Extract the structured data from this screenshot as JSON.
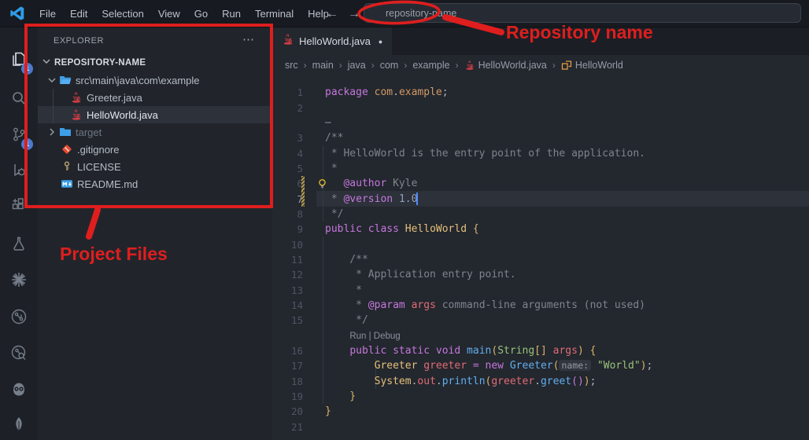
{
  "titlebar": {
    "menus": [
      "File",
      "Edit",
      "Selection",
      "View",
      "Go",
      "Run",
      "Terminal",
      "Help"
    ],
    "back_icon": "←",
    "forward_icon": "→",
    "search_value": "repository-name"
  },
  "activity_bar": {
    "items": [
      {
        "name": "explorer",
        "badge": "1"
      },
      {
        "name": "search"
      },
      {
        "name": "source-control",
        "badge": "1"
      },
      {
        "name": "run-debug"
      },
      {
        "name": "extensions"
      },
      {
        "name": "testing-flask"
      },
      {
        "name": "sparkle"
      },
      {
        "name": "git-graph"
      },
      {
        "name": "git-history-search"
      },
      {
        "name": "owl-assistant"
      },
      {
        "name": "mongodb-leaf"
      }
    ]
  },
  "explorer": {
    "title": "EXPLORER",
    "more_icon": "⋯",
    "section": "REPOSITORY-NAME",
    "tree": [
      {
        "label": "src\\main\\java\\com\\example",
        "icon": "folder-open",
        "chevron": "down",
        "depth": 1
      },
      {
        "label": "Greeter.java",
        "icon": "java",
        "depth": 2
      },
      {
        "label": "HelloWorld.java",
        "icon": "java",
        "depth": 2,
        "selected": true
      },
      {
        "label": "target",
        "icon": "folder",
        "chevron": "right",
        "depth": 1,
        "dimmed": true
      },
      {
        "label": ".gitignore",
        "icon": "git",
        "depth": 1
      },
      {
        "label": "LICENSE",
        "icon": "key",
        "depth": 1
      },
      {
        "label": "README.md",
        "icon": "markdown",
        "depth": 1
      }
    ]
  },
  "editor": {
    "tab": {
      "label": "HelloWorld.java",
      "modified_dot": "●"
    },
    "breadcrumbs": [
      {
        "label": "src"
      },
      {
        "label": "main"
      },
      {
        "label": "java"
      },
      {
        "label": "com"
      },
      {
        "label": "example"
      },
      {
        "label": "HelloWorld.java",
        "icon": "java"
      },
      {
        "label": "HelloWorld",
        "icon": "symbol-class"
      }
    ],
    "palette": {
      "kw": "#c678dd",
      "cls": "#e5c07b",
      "cls2": "#98c379",
      "fn": "#61afef",
      "str": "#98c379",
      "var": "#e06c75",
      "cm": "#7f848e",
      "tag": "#c678dd",
      "pkg": "#d19a66",
      "b1": "#d8b46a",
      "b2": "#c678dd",
      "pl": "#abb2bf",
      "num": "#8fa1b9",
      "lens": "#8b929c",
      "inlay": "#959ba4",
      "background": "#23272e",
      "current_line": "#2c313a",
      "cursor": "#528bff"
    },
    "lines": [
      {
        "n": "1",
        "tokens": [
          {
            "t": "package",
            "c": "kw"
          },
          {
            "t": " ",
            "c": "pl"
          },
          {
            "t": "com",
            "c": "pkg"
          },
          {
            "t": ".",
            "c": "pl"
          },
          {
            "t": "example",
            "c": "pkg"
          },
          {
            "t": ";",
            "c": "pl"
          }
        ]
      },
      {
        "n": "2",
        "tokens": []
      },
      {
        "n": "",
        "fold": true,
        "tokens": [
          {
            "t": "⋯",
            "c": "cm"
          }
        ]
      },
      {
        "n": "3",
        "tokens": [
          {
            "t": "/**",
            "c": "cm"
          }
        ]
      },
      {
        "n": "4",
        "tokens": [
          {
            "t": " * HelloWorld is the entry point of the application.",
            "c": "cm"
          }
        ]
      },
      {
        "n": "5",
        "tokens": [
          {
            "t": " *",
            "c": "cm"
          }
        ]
      },
      {
        "n": "6",
        "modified": true,
        "bulb": true,
        "tokens": [
          {
            "t": "   ",
            "c": "cm"
          },
          {
            "t": "@author",
            "c": "tag"
          },
          {
            "t": " Kyle",
            "c": "cm"
          }
        ]
      },
      {
        "n": "7",
        "modified": true,
        "current": true,
        "cursor": true,
        "tokens": [
          {
            "t": " * ",
            "c": "cm"
          },
          {
            "t": "@version",
            "c": "tag"
          },
          {
            "t": " ",
            "c": "cm"
          },
          {
            "t": "1.0",
            "c": "num"
          }
        ]
      },
      {
        "n": "8",
        "tokens": [
          {
            "t": " */",
            "c": "cm"
          }
        ]
      },
      {
        "n": "9",
        "tokens": [
          {
            "t": "public",
            "c": "kw"
          },
          {
            "t": " ",
            "c": "pl"
          },
          {
            "t": "class",
            "c": "kw"
          },
          {
            "t": " ",
            "c": "pl"
          },
          {
            "t": "HelloWorld",
            "c": "cls"
          },
          {
            "t": " ",
            "c": "pl"
          },
          {
            "t": "{",
            "c": "b1"
          }
        ]
      },
      {
        "n": "10",
        "tokens": []
      },
      {
        "n": "11",
        "tokens": [
          {
            "t": "    /**",
            "c": "cm"
          }
        ]
      },
      {
        "n": "12",
        "tokens": [
          {
            "t": "     * Application entry point.",
            "c": "cm"
          }
        ]
      },
      {
        "n": "13",
        "tokens": [
          {
            "t": "     *",
            "c": "cm"
          }
        ]
      },
      {
        "n": "14",
        "tokens": [
          {
            "t": "     * ",
            "c": "cm"
          },
          {
            "t": "@param",
            "c": "tag"
          },
          {
            "t": " ",
            "c": "cm"
          },
          {
            "t": "args",
            "c": "var"
          },
          {
            "t": " command-line arguments (not used)",
            "c": "cm"
          }
        ]
      },
      {
        "n": "15",
        "tokens": [
          {
            "t": "     */",
            "c": "cm"
          }
        ]
      },
      {
        "n": "",
        "lens": true,
        "tokens": [
          {
            "t": "    ",
            "c": "pl"
          },
          {
            "t": "Run | Debug",
            "c": "lens",
            "lens": true
          }
        ]
      },
      {
        "n": "16",
        "tokens": [
          {
            "t": "    ",
            "c": "pl"
          },
          {
            "t": "public",
            "c": "kw"
          },
          {
            "t": " ",
            "c": "pl"
          },
          {
            "t": "static",
            "c": "kw"
          },
          {
            "t": " ",
            "c": "pl"
          },
          {
            "t": "void",
            "c": "kw"
          },
          {
            "t": " ",
            "c": "pl"
          },
          {
            "t": "main",
            "c": "fn"
          },
          {
            "t": "(",
            "c": "b1"
          },
          {
            "t": "String",
            "c": "cls2"
          },
          {
            "t": "[]",
            "c": "b1"
          },
          {
            "t": " ",
            "c": "pl"
          },
          {
            "t": "args",
            "c": "var"
          },
          {
            "t": ")",
            "c": "b1"
          },
          {
            "t": " ",
            "c": "pl"
          },
          {
            "t": "{",
            "c": "b1"
          }
        ]
      },
      {
        "n": "17",
        "tokens": [
          {
            "t": "        ",
            "c": "pl"
          },
          {
            "t": "Greeter",
            "c": "cls"
          },
          {
            "t": " ",
            "c": "pl"
          },
          {
            "t": "greeter",
            "c": "var"
          },
          {
            "t": " ",
            "c": "pl"
          },
          {
            "t": "=",
            "c": "kw"
          },
          {
            "t": " ",
            "c": "pl"
          },
          {
            "t": "new",
            "c": "kw"
          },
          {
            "t": " ",
            "c": "pl"
          },
          {
            "t": "Greeter",
            "c": "fn"
          },
          {
            "t": "(",
            "c": "b1"
          },
          {
            "t": "name:",
            "c": "inlay",
            "inlay": true
          },
          {
            "t": " ",
            "c": "pl"
          },
          {
            "t": "\"World\"",
            "c": "str"
          },
          {
            "t": ")",
            "c": "b1"
          },
          {
            "t": ";",
            "c": "pl"
          }
        ]
      },
      {
        "n": "18",
        "tokens": [
          {
            "t": "        ",
            "c": "pl"
          },
          {
            "t": "System",
            "c": "cls"
          },
          {
            "t": ".",
            "c": "pl"
          },
          {
            "t": "out",
            "c": "var"
          },
          {
            "t": ".",
            "c": "pl"
          },
          {
            "t": "println",
            "c": "fn"
          },
          {
            "t": "(",
            "c": "b1"
          },
          {
            "t": "greeter",
            "c": "var"
          },
          {
            "t": ".",
            "c": "pl"
          },
          {
            "t": "greet",
            "c": "fn"
          },
          {
            "t": "()",
            "c": "b2"
          },
          {
            "t": ")",
            "c": "b1"
          },
          {
            "t": ";",
            "c": "pl"
          }
        ]
      },
      {
        "n": "19",
        "tokens": [
          {
            "t": "    }",
            "c": "b1"
          }
        ]
      },
      {
        "n": "20",
        "tokens": [
          {
            "t": "}",
            "c": "b1"
          }
        ]
      },
      {
        "n": "21",
        "tokens": []
      }
    ]
  },
  "annotations": {
    "color": "#df1e1e",
    "repo_label": "Repository name",
    "files_label": "Project Files"
  }
}
